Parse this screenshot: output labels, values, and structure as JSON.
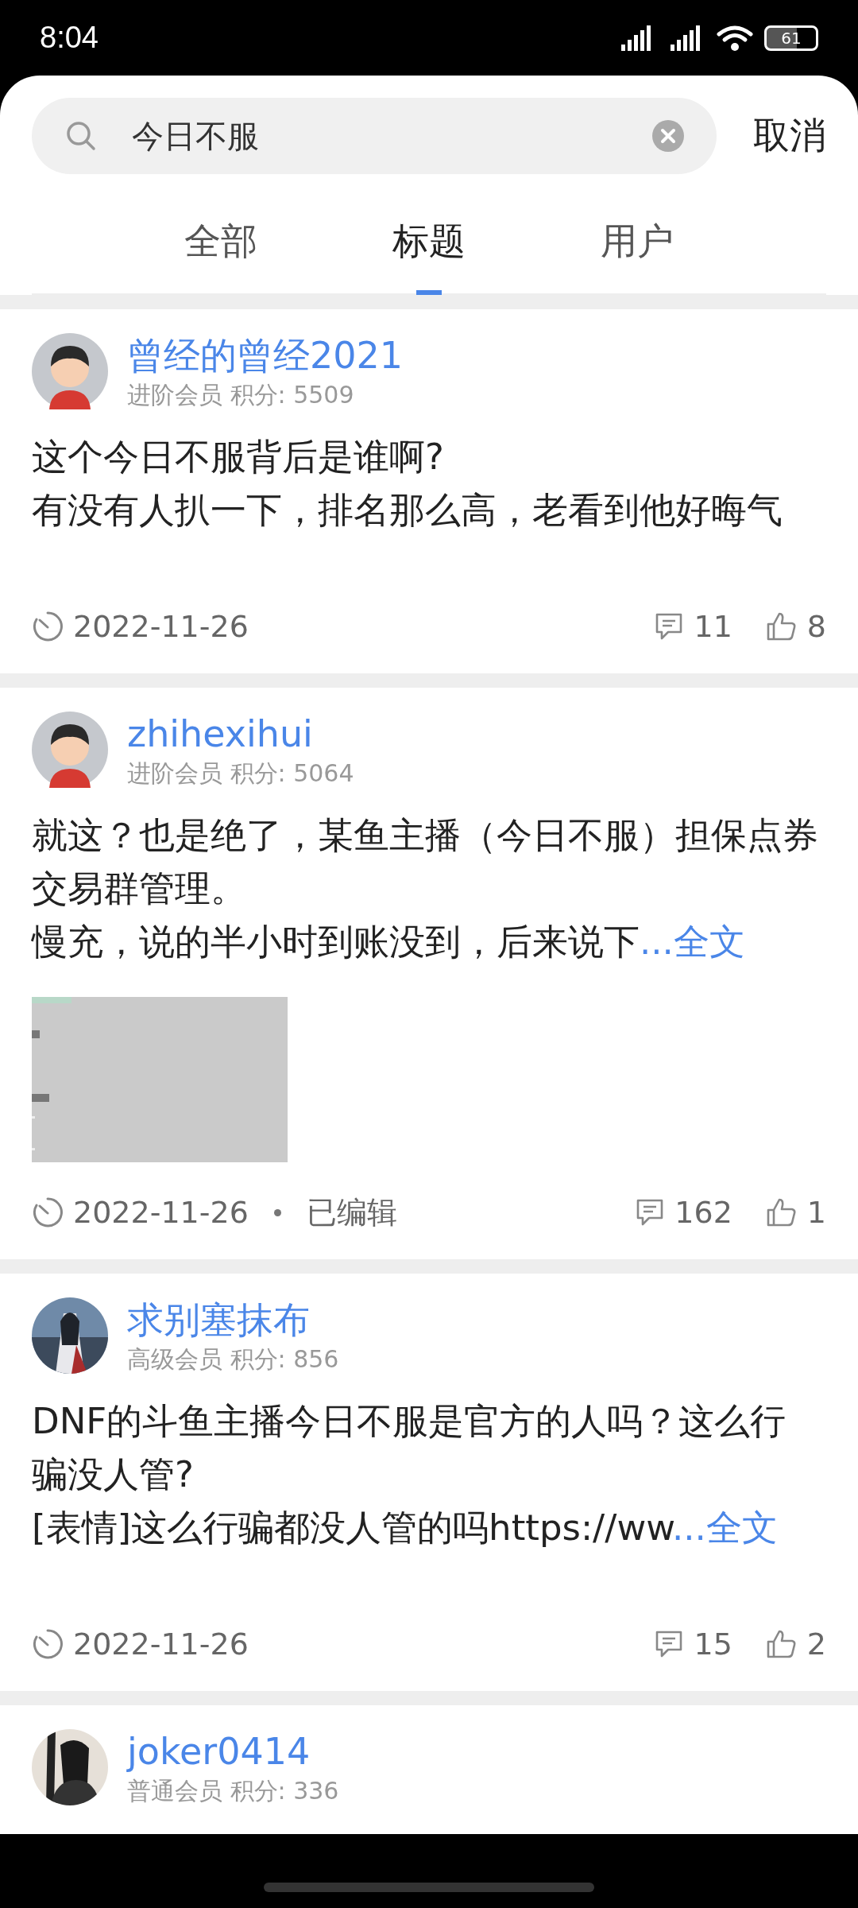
{
  "status_bar": {
    "time": "8:04",
    "battery": "61"
  },
  "search": {
    "value": "今日不服",
    "cancel": "取消"
  },
  "tabs": [
    {
      "label": "全部",
      "selected": false
    },
    {
      "label": "标题",
      "selected": true
    },
    {
      "label": "用户",
      "selected": false
    }
  ],
  "posts": [
    {
      "avatar": {
        "kind": "cartoon"
      },
      "name": "曾经的曾经2021",
      "member": "进阶会员 积分: 5509",
      "lines": [
        "这个今日不服背后是谁啊?",
        "有没有人扒一下，排名那么高，老看到他好晦气"
      ],
      "date": "2022-11-26",
      "comments": "11",
      "likes": "8"
    },
    {
      "avatar": {
        "kind": "cartoon"
      },
      "name": "zhihexihui",
      "member": "进阶会员 积分: 5064",
      "lines": [
        "就这？也是绝了，某鱼主播（今日不服）担保点券交易群管理。",
        " 慢充，说的半小时到账没到，后来说下"
      ],
      "more": "...全文",
      "image": {
        "kind": "picture"
      },
      "date": "2022-11-26",
      "edited": "已编辑",
      "comments": "162",
      "likes": "1"
    },
    {
      "avatar": {
        "kind": "picture"
      },
      "name": "求别塞抹布",
      "member": "高级会员 积分: 856",
      "lines": [
        "DNF的斗鱼主播今日不服是官方的人吗？这么行骗没人管?",
        "[表情]这么行骗都没人管的吗https://ww"
      ],
      "more": "...全文",
      "date": "2022-11-26",
      "comments": "15",
      "likes": "2"
    },
    {
      "avatar": {
        "kind": "picture"
      },
      "name": "joker0414",
      "member": "普通会员 积分: 336"
    }
  ]
}
